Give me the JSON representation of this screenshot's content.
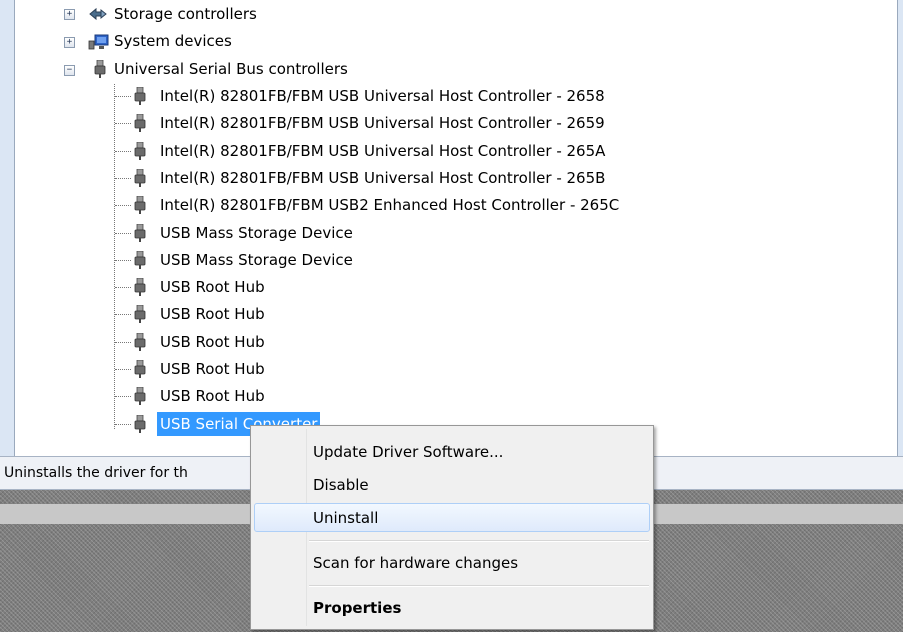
{
  "device_tree": {
    "categories": [
      {
        "label": "Storage controllers",
        "expander": "+",
        "icon": "storage-controller-icon"
      },
      {
        "label": "System devices",
        "expander": "+",
        "icon": "system-device-icon"
      },
      {
        "label": "Universal Serial Bus controllers",
        "expander": "−",
        "icon": "usb-plug-icon"
      }
    ],
    "usb_devices": [
      {
        "label": "Intel(R) 82801FB/FBM USB Universal Host Controller - 2658",
        "icon": "usb-plug-icon"
      },
      {
        "label": "Intel(R) 82801FB/FBM USB Universal Host Controller - 2659",
        "icon": "usb-plug-icon"
      },
      {
        "label": "Intel(R) 82801FB/FBM USB Universal Host Controller - 265A",
        "icon": "usb-plug-icon"
      },
      {
        "label": "Intel(R) 82801FB/FBM USB Universal Host Controller - 265B",
        "icon": "usb-plug-icon"
      },
      {
        "label": "Intel(R) 82801FB/FBM USB2 Enhanced Host Controller - 265C",
        "icon": "usb-plug-icon"
      },
      {
        "label": "USB Mass Storage Device",
        "icon": "usb-plug-icon"
      },
      {
        "label": "USB Mass Storage Device",
        "icon": "usb-plug-icon"
      },
      {
        "label": "USB Root Hub",
        "icon": "usb-plug-icon"
      },
      {
        "label": "USB Root Hub",
        "icon": "usb-plug-icon"
      },
      {
        "label": "USB Root Hub",
        "icon": "usb-plug-icon"
      },
      {
        "label": "USB Root Hub",
        "icon": "usb-plug-icon"
      },
      {
        "label": "USB Root Hub",
        "icon": "usb-plug-icon"
      },
      {
        "label": "USB Serial Converter",
        "icon": "usb-plug-icon",
        "selected": true
      }
    ]
  },
  "status_bar": {
    "text": "Uninstalls the driver for th"
  },
  "context_menu": {
    "items": [
      {
        "label": "Update Driver Software..."
      },
      {
        "label": "Disable"
      },
      {
        "label": "Uninstall",
        "highlighted": true
      },
      {
        "label": "Scan for hardware changes"
      },
      {
        "label": "Properties",
        "bold": true
      }
    ]
  },
  "colors": {
    "selection": "#3399ff",
    "menu_background": "#f0f0f0",
    "menu_hover": "#dfeafb",
    "menu_hover_border": "#aecff7",
    "status_bar": "#eef1f6",
    "desktop": "#7e7e7e"
  }
}
